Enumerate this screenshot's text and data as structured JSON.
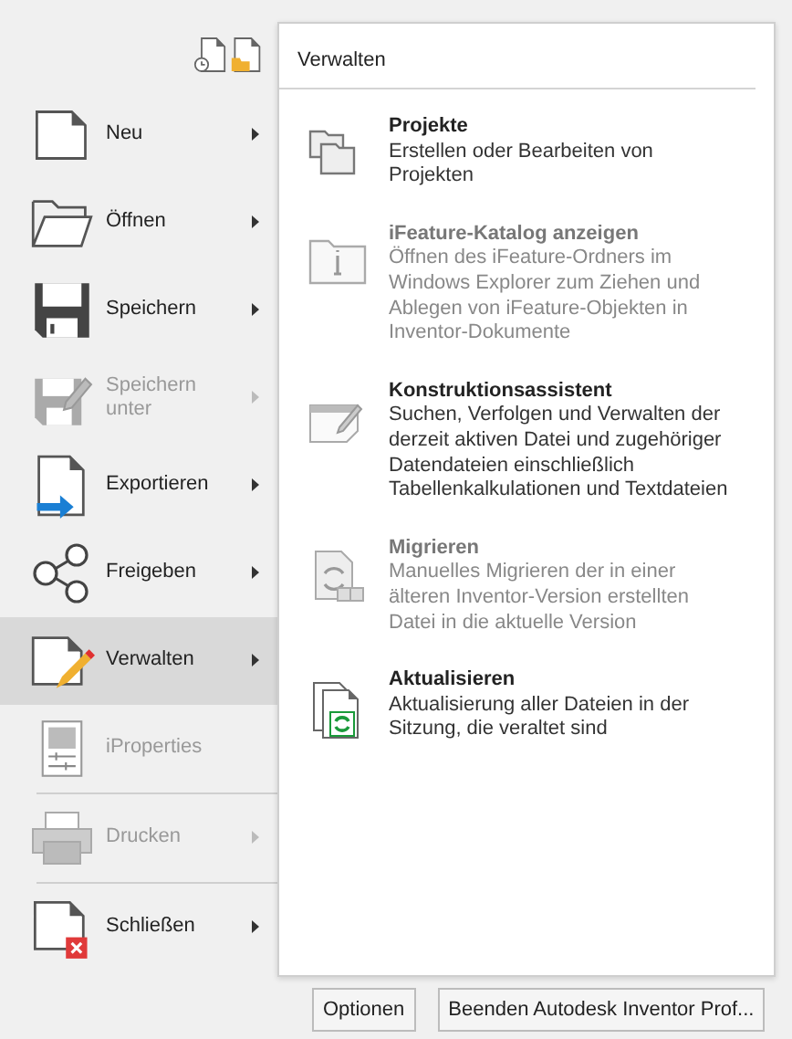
{
  "quick_access": [
    {
      "kind": "recent"
    },
    {
      "kind": "open-folder"
    }
  ],
  "menu": [
    {
      "kind": "new",
      "label": "Neu",
      "has_submenu": true,
      "disabled": false,
      "selected": false,
      "separator_after": false
    },
    {
      "kind": "open",
      "label": "Öffnen",
      "has_submenu": true,
      "disabled": false,
      "selected": false,
      "separator_after": false
    },
    {
      "kind": "save",
      "label": "Speichern",
      "has_submenu": true,
      "disabled": false,
      "selected": false,
      "separator_after": false
    },
    {
      "kind": "save-as",
      "label": "Speichern unter",
      "has_submenu": true,
      "disabled": true,
      "selected": false,
      "separator_after": false
    },
    {
      "kind": "export",
      "label": "Exportieren",
      "has_submenu": true,
      "disabled": false,
      "selected": false,
      "separator_after": false
    },
    {
      "kind": "share",
      "label": "Freigeben",
      "has_submenu": true,
      "disabled": false,
      "selected": false,
      "separator_after": false
    },
    {
      "kind": "manage",
      "label": "Verwalten",
      "has_submenu": true,
      "disabled": false,
      "selected": true,
      "separator_after": false
    },
    {
      "kind": "iproperties",
      "label": "iProperties",
      "has_submenu": false,
      "disabled": true,
      "selected": false,
      "separator_after": true
    },
    {
      "kind": "print",
      "label": "Drucken",
      "has_submenu": true,
      "disabled": true,
      "selected": false,
      "separator_after": true
    },
    {
      "kind": "close",
      "label": "Schließen",
      "has_submenu": true,
      "disabled": false,
      "selected": false,
      "separator_after": false
    }
  ],
  "panel": {
    "title": "Verwalten",
    "entries": [
      {
        "kind": "projects",
        "title": "Projekte",
        "description": "Erstellen oder Bearbeiten von Projekten",
        "disabled": false
      },
      {
        "kind": "catalog",
        "title": "iFeature-Katalog anzeigen",
        "description": "Öffnen des iFeature-Ordners im Windows Explorer zum Ziehen und Ablegen von iFeature-Objekten in Inventor-Dokumente",
        "disabled": true
      },
      {
        "kind": "assistant",
        "title": "Konstruktionsassistent",
        "description": "Suchen, Verfolgen und Verwalten der derzeit aktiven Datei und zugehöriger Datendateien einschließlich Tabellenkalkulationen und Textdateien",
        "disabled": false
      },
      {
        "kind": "migrate",
        "title": "Migrieren",
        "description": "Manuelles Migrieren der in einer älteren Inventor-Version erstellten Datei in die aktuelle Version",
        "disabled": true
      },
      {
        "kind": "update",
        "title": "Aktualisieren",
        "description": "Aktualisierung aller Dateien in der Sitzung, die veraltet sind",
        "disabled": false
      }
    ]
  },
  "buttons": [
    "Optionen",
    "Beenden Autodesk Inventor Prof..."
  ]
}
